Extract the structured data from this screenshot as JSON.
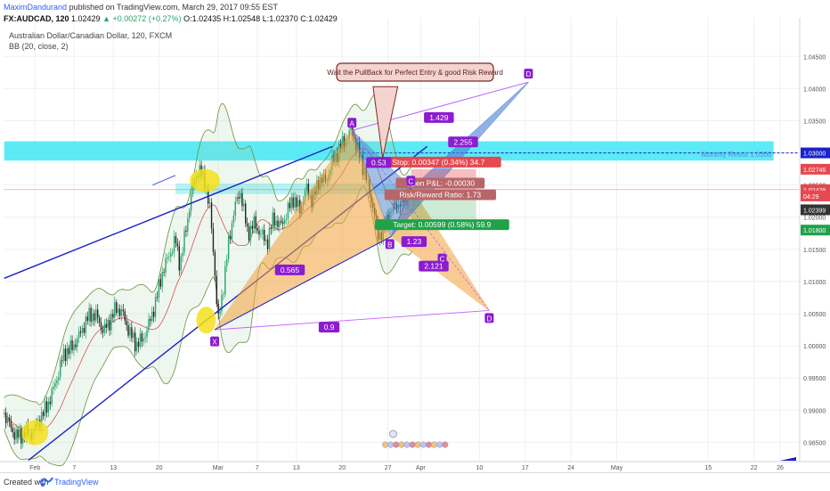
{
  "header": {
    "author": "MaximDandurand",
    "published_text": "published on TradingView.com, March 29, 2017 09:55 EST",
    "symbol": "FX:AUDCAD, 120",
    "last": "1.02429",
    "change": "▲ +0.00272 (+0.27%)",
    "open": "O:1.02435",
    "high": "H:1.02548",
    "low": "L:1.02370",
    "close": "C:1.02429"
  },
  "legend": {
    "instrument": "Australian Dollar/Canadian Dollar, 120, FXCM",
    "indicator": "BB (20, close, 2)"
  },
  "footer": {
    "created_with": "Created with",
    "brand": "TradingView"
  },
  "colors": {
    "up_candle": "#2aa36b",
    "down_candle": "#222222",
    "bb_line": "#6b8f3a",
    "pattern_orange": "#f4a23c",
    "pattern_blue": "#4a7fd8",
    "label_purple": "#8b1ccf",
    "trend_navy": "#1a22c8",
    "resist_cyan": "#3fe6f5",
    "stop_red": "#e6484f",
    "target_green": "#21a24a",
    "callout_fill": "#f3d4cf",
    "callout_border": "#7b2a24",
    "highlight_yellow": "#f4e11c"
  },
  "chart_data": {
    "type": "line",
    "title": "Australian Dollar/Canadian Dollar, 120, FXCM",
    "ylim": [
      0.982,
      1.051
    ],
    "yticks": [
      "1.04500",
      "1.04000",
      "1.03500",
      "1.03000",
      "1.02500",
      "1.02000",
      "1.01500",
      "1.01000",
      "1.00500",
      "1.00000",
      "0.99500",
      "0.99000",
      "0.98500"
    ],
    "xticks": [
      {
        "label": "Feb",
        "day": 31
      },
      {
        "label": "7",
        "day": 37
      },
      {
        "label": "13",
        "day": 43
      },
      {
        "label": "20",
        "day": 50
      },
      {
        "label": "Mar",
        "day": 59
      },
      {
        "label": "7",
        "day": 65
      },
      {
        "label": "13",
        "day": 71
      },
      {
        "label": "20",
        "day": 78
      },
      {
        "label": "27",
        "day": 85
      },
      {
        "label": "Apr",
        "day": 90
      },
      {
        "label": "10",
        "day": 99
      },
      {
        "label": "17",
        "day": 106
      },
      {
        "label": "24",
        "day": 113
      },
      {
        "label": "May",
        "day": 120
      },
      {
        "label": "15",
        "day": 134
      },
      {
        "label": "22",
        "day": 141
      },
      {
        "label": "26",
        "day": 145
      }
    ],
    "xlim": [
      26.2,
      148
    ],
    "price_path": [
      [
        26.3,
        0.9895
      ],
      [
        27.5,
        0.9868
      ],
      [
        28.5,
        0.9858
      ],
      [
        29.5,
        0.9866
      ],
      [
        30.5,
        0.9862
      ],
      [
        31.5,
        0.9881
      ],
      [
        32.5,
        0.9899
      ],
      [
        33.5,
        0.9922
      ],
      [
        34.5,
        0.9955
      ],
      [
        35.5,
        0.999
      ],
      [
        36.5,
        0.9995
      ],
      [
        37.5,
        1.001
      ],
      [
        38.5,
        1.0032
      ],
      [
        39.5,
        1.005
      ],
      [
        40.5,
        1.0045
      ],
      [
        41.5,
        1.0022
      ],
      [
        42.5,
        1.004
      ],
      [
        43.5,
        1.006
      ],
      [
        44.5,
        1.0048
      ],
      [
        45.5,
        1.002
      ],
      [
        46.5,
        1.0002
      ],
      [
        47.5,
        1.001
      ],
      [
        48.5,
        1.0035
      ],
      [
        49.5,
        1.007
      ],
      [
        50.5,
        1.0115
      ],
      [
        51.5,
        1.014
      ],
      [
        52.5,
        1.0165
      ],
      [
        53.2,
        1.0125
      ],
      [
        54,
        1.0175
      ],
      [
        55,
        1.024
      ],
      [
        56,
        1.0275
      ],
      [
        57,
        1.0255
      ],
      [
        57.8,
        1.021
      ],
      [
        58.5,
        1.012
      ],
      [
        59,
        1.0035
      ],
      [
        59.6,
        1.0075
      ],
      [
        60.5,
        1.015
      ],
      [
        61.5,
        1.0215
      ],
      [
        62.5,
        1.024
      ],
      [
        63.5,
        1.0175
      ],
      [
        64.5,
        1.019
      ],
      [
        65.5,
        1.0175
      ],
      [
        66.5,
        1.016
      ],
      [
        67.5,
        1.02
      ],
      [
        68.5,
        1.0185
      ],
      [
        69.5,
        1.0205
      ],
      [
        70.5,
        1.023
      ],
      [
        71.5,
        1.021
      ],
      [
        72.5,
        1.0245
      ],
      [
        73.5,
        1.0225
      ],
      [
        74.5,
        1.026
      ],
      [
        75.5,
        1.0255
      ],
      [
        76.5,
        1.0285
      ],
      [
        77.5,
        1.0305
      ],
      [
        78.5,
        1.0322
      ],
      [
        79.5,
        1.0335
      ],
      [
        80.5,
        1.03
      ],
      [
        81.5,
        1.027
      ],
      [
        82,
        1.0245
      ],
      [
        82.8,
        1.0215
      ],
      [
        83.5,
        1.017
      ],
      [
        84.5,
        1.0185
      ],
      [
        85.5,
        1.0212
      ],
      [
        86.5,
        1.022
      ],
      [
        87.5,
        1.0228
      ],
      [
        88.5,
        1.0242
      ],
      [
        88.9,
        1.0243
      ]
    ],
    "last_price": 1.02429,
    "axis_tags": [
      {
        "value": "1.03000",
        "y": 1.03,
        "bg": "#1a22c8"
      },
      {
        "value": "1.02746",
        "y": 1.02746,
        "bg": "#e6484f"
      },
      {
        "value": "1.02429",
        "y": 1.02429,
        "bg": "#e6484f"
      },
      {
        "value": "04:29",
        "y": 1.0233,
        "bg": "#e6484f"
      },
      {
        "value": "1.02399",
        "y": 1.02115,
        "bg": "#333333"
      },
      {
        "value": "1.01800",
        "y": 1.018,
        "bg": "#21a24a"
      }
    ],
    "resistance": {
      "label": "Monthly Resist 1.0300",
      "y0": 1.0288,
      "y1": 1.0318,
      "line": 1.03,
      "x0": 26.3,
      "x1": 144
    },
    "orange_pattern": [
      {
        "name": "X",
        "x": 58.5,
        "y": 1.0025
      },
      {
        "name": "A",
        "x": 79.5,
        "y": 1.0335
      },
      {
        "name": "B",
        "x": 85.5,
        "y": 1.017
      },
      {
        "name": "C",
        "x": 88.6,
        "y": 1.0245
      },
      {
        "name": "D",
        "x": 100.5,
        "y": 1.0055
      }
    ],
    "blue_pattern": [
      {
        "name": "A",
        "x": 79.5,
        "y": 1.0335
      },
      {
        "name": "B",
        "x": 85.5,
        "y": 1.017
      },
      {
        "name": "C",
        "x": 88.6,
        "y": 1.0245
      },
      {
        "name": "D",
        "x": 106.5,
        "y": 1.041
      }
    ],
    "ratios": [
      {
        "label": "0.565",
        "x": 70,
        "y": 1.0118
      },
      {
        "label": "0.53",
        "x": 83.6,
        "y": 1.0285
      },
      {
        "label": "1.429",
        "x": 92.8,
        "y": 1.0355
      },
      {
        "label": "2.255",
        "x": 96.5,
        "y": 1.0317
      },
      {
        "label": "1.23",
        "x": 89,
        "y": 1.0162
      },
      {
        "label": "2.121",
        "x": 92,
        "y": 1.0124
      },
      {
        "label": "0.9",
        "x": 76,
        "y": 1.0029
      }
    ],
    "point_labels": [
      {
        "name": "X",
        "x": 58.5,
        "y": 1.002,
        "dy": 10
      },
      {
        "name": "A",
        "x": 79.5,
        "y": 1.0335,
        "dy": -8
      },
      {
        "name": "B",
        "x": 85.3,
        "y": 1.017,
        "dy": 9
      },
      {
        "name": "C",
        "x": 88.5,
        "y": 1.0245,
        "dy": -8
      },
      {
        "name": "C",
        "x": 93.3,
        "y": 1.0135,
        "dy": 0
      },
      {
        "name": "D",
        "x": 100.5,
        "y": 1.0055,
        "dy": 9
      },
      {
        "name": "D",
        "x": 106.5,
        "y": 1.041,
        "dy": -9
      }
    ],
    "callout": "Wait the PullBack for Perfect Entry & good Risk Reward",
    "position": {
      "x0": 88.6,
      "x1": 98.5,
      "entry": 1.02435,
      "stop": 1.02746,
      "target": 1.018,
      "stop_label": "Stop: 0.00347 (0.34%) 34.7",
      "pnl_label": "Open P&L: -0.00030",
      "rr_label": "Risk/Reward Ratio: 1.73",
      "target_label": "Target: 0.00599 (0.58%) 59.9"
    }
  }
}
